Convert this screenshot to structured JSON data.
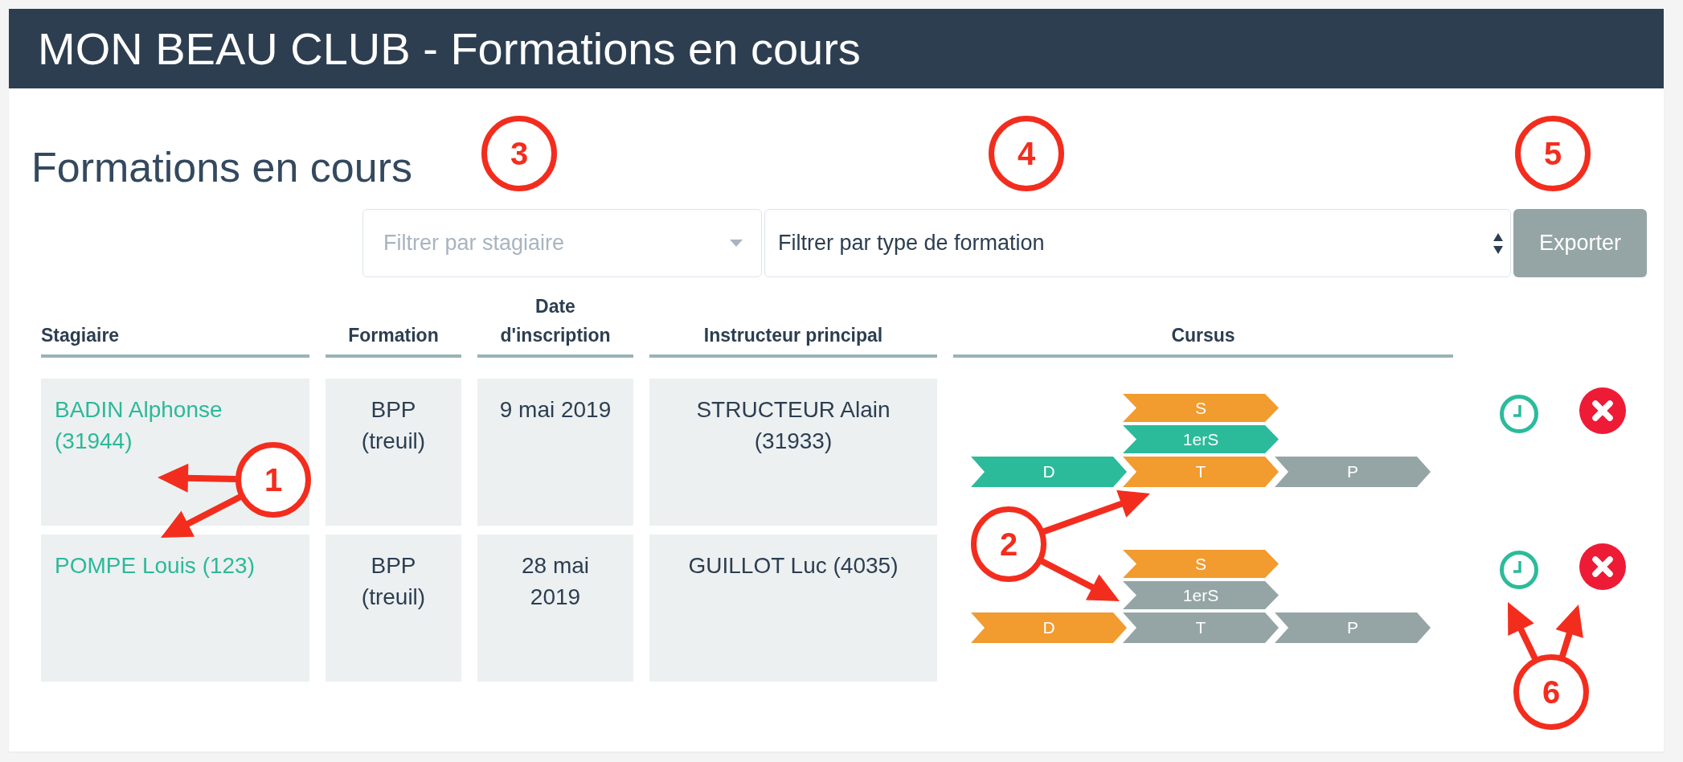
{
  "header": {
    "title": "MON BEAU CLUB - Formations en cours"
  },
  "page_title": "Formations en cours",
  "filters": {
    "trainee": {
      "placeholder": "Filtrer par stagiaire"
    },
    "training_type": {
      "value": "Filtrer par type de formation"
    }
  },
  "export_button": {
    "label": "Exporter"
  },
  "table": {
    "columns": [
      "Stagiaire",
      "Formation",
      "Date d'inscription",
      "Instructeur principal",
      "Cursus"
    ],
    "rows": [
      {
        "trainee": "BADIN Alphonse (31944)",
        "training": "BPP (treuil)",
        "date": "9 mai 2019",
        "instructor": "STRUCTEUR Alain (31933)",
        "cursus": [
          {
            "steps": [
              {
                "label": "D",
                "color": "#2bbb9b"
              }
            ]
          },
          {
            "steps": [
              {
                "label": "S",
                "color": "#f29b2f"
              },
              {
                "label": "1erS",
                "color": "#2bbb9b"
              },
              {
                "label": "T",
                "color": "#f29b2f"
              }
            ]
          },
          {
            "steps": [
              {
                "label": "P",
                "color": "#95a5a6"
              }
            ]
          }
        ]
      },
      {
        "trainee": "POMPE Louis (123)",
        "training": "BPP (treuil)",
        "date": "28 mai 2019",
        "instructor": "GUILLOT Luc (4035)",
        "cursus": [
          {
            "steps": [
              {
                "label": "D",
                "color": "#f29b2f"
              }
            ]
          },
          {
            "steps": [
              {
                "label": "S",
                "color": "#f29b2f"
              },
              {
                "label": "1erS",
                "color": "#95a5a6"
              },
              {
                "label": "T",
                "color": "#95a5a6"
              }
            ]
          },
          {
            "steps": [
              {
                "label": "P",
                "color": "#95a5a6"
              }
            ]
          }
        ]
      }
    ]
  },
  "callouts": [
    {
      "number": "3"
    },
    {
      "number": "4"
    },
    {
      "number": "5"
    },
    {
      "number": "1"
    },
    {
      "number": "2"
    },
    {
      "number": "6"
    }
  ]
}
